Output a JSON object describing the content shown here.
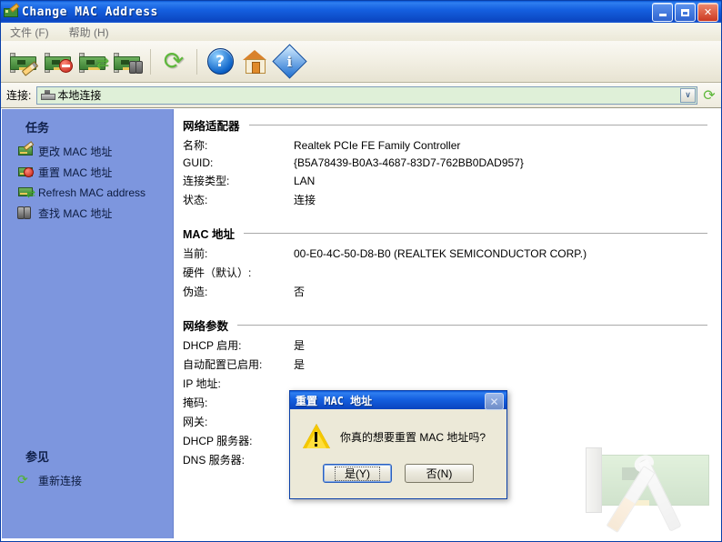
{
  "window": {
    "title": "Change MAC Address",
    "icon": "nic-pencil-icon",
    "buttons": {
      "minimize": "_",
      "maximize": "□",
      "close": "✕"
    }
  },
  "menu": {
    "items": [
      {
        "label": "文件 (F)"
      },
      {
        "label": "帮助 (H)"
      }
    ]
  },
  "toolbar": {
    "items": [
      {
        "name": "change-mac",
        "icon": "nic-pencil-icon"
      },
      {
        "name": "reset-mac",
        "icon": "nic-stop-icon"
      },
      {
        "name": "refresh-mac",
        "icon": "nic-arrows-icon"
      },
      {
        "name": "find-mac",
        "icon": "nic-binoculars-icon"
      },
      {
        "name": "reconnect",
        "icon": "green-refresh-icon"
      },
      {
        "name": "help",
        "icon": "question-mark-icon"
      },
      {
        "name": "home",
        "icon": "house-icon"
      },
      {
        "name": "about",
        "icon": "info-diamond-icon"
      }
    ]
  },
  "connection": {
    "label": "连接:",
    "selected": "本地连接",
    "dropdown_glyph": "∨",
    "refresh_glyph": "⟳"
  },
  "sidebar": {
    "tasks_heading": "任务",
    "tasks": [
      {
        "label": "更改 MAC 地址",
        "icon": "nic-pencil-icon"
      },
      {
        "label": "重置 MAC 地址",
        "icon": "nic-stop-icon"
      },
      {
        "label": "Refresh MAC address",
        "icon": "nic-arrows-icon"
      },
      {
        "label": "查找 MAC 地址",
        "icon": "binoculars-icon"
      }
    ],
    "seealso_heading": "参见",
    "seealso": [
      {
        "label": "重新连接",
        "icon": "green-refresh-icon",
        "glyph": "⟳"
      }
    ]
  },
  "sections": [
    {
      "heading": "网络适配器",
      "rows": [
        {
          "key": "名称:",
          "value": "Realtek PCIe FE Family Controller"
        },
        {
          "key": "GUID:",
          "value": "{B5A78439-B0A3-4687-83D7-762BB0DAD957}"
        },
        {
          "key": "连接类型:",
          "value": "LAN"
        },
        {
          "key": "状态:",
          "value": "连接"
        }
      ]
    },
    {
      "heading": "MAC 地址",
      "rows": [
        {
          "key": "当前:",
          "value": "00-E0-4C-50-D8-B0 (REALTEK SEMICONDUCTOR CORP.)"
        },
        {
          "key": "硬件（默认）:",
          "value": ""
        },
        {
          "key": "伪造:",
          "value": "否"
        }
      ]
    },
    {
      "heading": "网络参数",
      "rows": [
        {
          "key": "DHCP 启用:",
          "value": "是"
        },
        {
          "key": "自动配置已启用:",
          "value": "是"
        },
        {
          "key": "IP 地址:",
          "value": ""
        },
        {
          "key": "掩码:",
          "value": ""
        },
        {
          "key": "网关:",
          "value": ""
        },
        {
          "key": "DHCP 服务器:",
          "value": ""
        },
        {
          "key": "DNS 服务器:",
          "value": ""
        }
      ]
    }
  ],
  "dialog": {
    "title": "重置 MAC 地址",
    "close_glyph": "✕",
    "icon": "warning-icon",
    "message": "你真的想要重置 MAC 地址吗?",
    "yes_label": "是(Y)",
    "no_label": "否(N)"
  },
  "colors": {
    "titlebar_blue": "#1560e0",
    "sidebar_blue": "#7d96de",
    "toolbar_beige": "#ece9d8",
    "combo_green": "#dff0d8",
    "warning_yellow": "#f5c800"
  }
}
